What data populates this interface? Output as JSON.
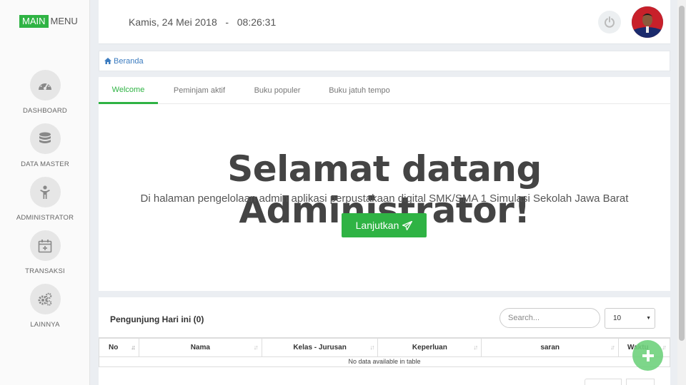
{
  "brand": {
    "main": "MAIN",
    "menu": "MENU"
  },
  "sidebar": {
    "items": [
      {
        "label": "DASHBOARD",
        "icon": "dashboard-gauge-icon"
      },
      {
        "label": "DATA MASTER",
        "icon": "database-icon"
      },
      {
        "label": "ADMINISTRATOR",
        "icon": "person-icon"
      },
      {
        "label": "TRANSAKSI",
        "icon": "calendar-plus-icon"
      },
      {
        "label": "LAINNYA",
        "icon": "gears-icon"
      }
    ]
  },
  "header": {
    "date": "Kamis, 24 Mei 2018",
    "separator": "-",
    "time": "08:26:31"
  },
  "breadcrumb": {
    "label": "Beranda"
  },
  "tabs": [
    {
      "label": "Welcome",
      "active": true
    },
    {
      "label": "Peminjam aktif",
      "active": false
    },
    {
      "label": "Buku populer",
      "active": false
    },
    {
      "label": "Buku jatuh tempo",
      "active": false
    }
  ],
  "hero": {
    "title": "Selamat datang Administrator!",
    "subtitle": "Di halaman pengelolaan admin aplikasi perpustakaan digital SMK/SMA 1 Simulasi Sekolah Jawa Barat",
    "button": "Lanjutkan"
  },
  "visitors": {
    "title": "Pengunjung Hari ini (0)",
    "search_placeholder": "Search...",
    "page_size": "10",
    "columns": [
      "No",
      "Nama",
      "Kelas - Jurusan",
      "Keperluan",
      "saran",
      "Waktu"
    ],
    "empty_message": "No data available in table"
  },
  "colors": {
    "accent": "#2fb344",
    "link": "#3b7bbf",
    "background": "#ebeef2"
  }
}
